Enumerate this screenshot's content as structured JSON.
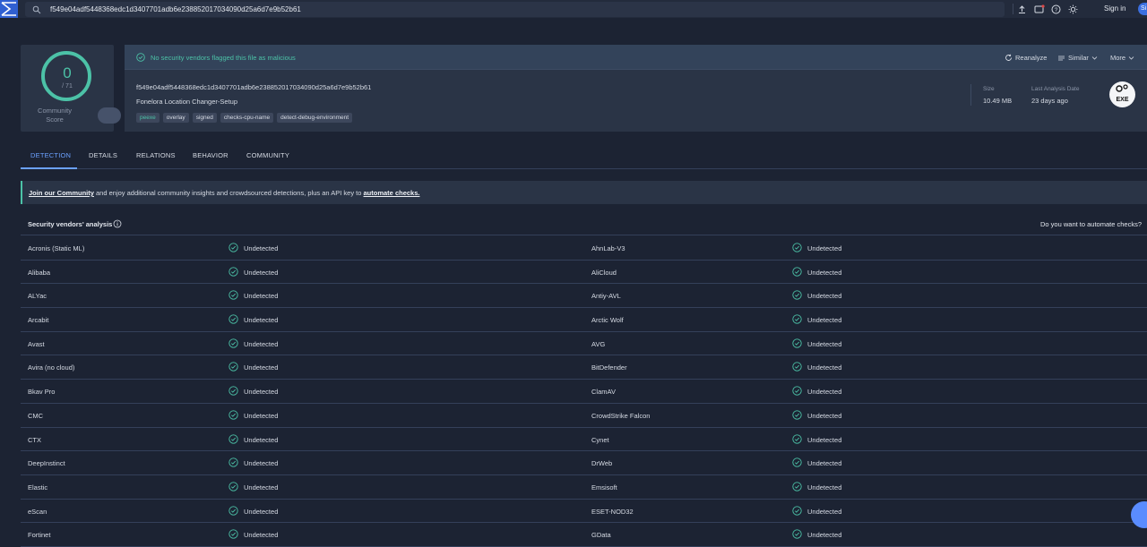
{
  "search": {
    "query": "f549e04adf5448368edc1d3407701adb6e238852017034090d25a6d7e9b52b61"
  },
  "topbar": {
    "sign_in": "Sign in",
    "sign_up": "Si"
  },
  "score": {
    "value": "0",
    "total": "/ 71",
    "community_label_line1": "Community",
    "community_label_line2": "Score"
  },
  "banner": {
    "message": "No security vendors flagged this file as malicious",
    "reanalyze": "Reanalyze",
    "similar": "Similar",
    "more": "More"
  },
  "file": {
    "hash": "f549e04adf5448368edc1d3407701adb6e238852017034090d25a6d7e9b52b61",
    "name": "Fonelora Location Changer-Setup",
    "tags": [
      "peexe",
      "overlay",
      "signed",
      "checks-cpu-name",
      "detect-debug-environment"
    ],
    "size_label": "Size",
    "size_value": "10.49 MB",
    "last_analysis_label": "Last Analysis Date",
    "last_analysis_value": "23 days ago",
    "type_badge": "EXE"
  },
  "tabs": [
    "DETECTION",
    "DETAILS",
    "RELATIONS",
    "BEHAVIOR",
    "COMMUNITY"
  ],
  "join": {
    "link1": "Join our Community",
    "mid": " and enjoy additional community insights and crowdsourced detections, plus an API key to ",
    "link2": "automate checks."
  },
  "vendors": {
    "title": "Security vendors' analysis",
    "automate": "Do you want to automate checks?",
    "rows": [
      {
        "left": "Acronis (Static ML)",
        "left_status": "Undetected",
        "right": "AhnLab-V3",
        "right_status": "Undetected"
      },
      {
        "left": "Alibaba",
        "left_status": "Undetected",
        "right": "AliCloud",
        "right_status": "Undetected"
      },
      {
        "left": "ALYac",
        "left_status": "Undetected",
        "right": "Antiy-AVL",
        "right_status": "Undetected"
      },
      {
        "left": "Arcabit",
        "left_status": "Undetected",
        "right": "Arctic Wolf",
        "right_status": "Undetected"
      },
      {
        "left": "Avast",
        "left_status": "Undetected",
        "right": "AVG",
        "right_status": "Undetected"
      },
      {
        "left": "Avira (no cloud)",
        "left_status": "Undetected",
        "right": "BitDefender",
        "right_status": "Undetected"
      },
      {
        "left": "Bkav Pro",
        "left_status": "Undetected",
        "right": "ClamAV",
        "right_status": "Undetected"
      },
      {
        "left": "CMC",
        "left_status": "Undetected",
        "right": "CrowdStrike Falcon",
        "right_status": "Undetected"
      },
      {
        "left": "CTX",
        "left_status": "Undetected",
        "right": "Cynet",
        "right_status": "Undetected"
      },
      {
        "left": "DeepInstinct",
        "left_status": "Undetected",
        "right": "DrWeb",
        "right_status": "Undetected"
      },
      {
        "left": "Elastic",
        "left_status": "Undetected",
        "right": "Emsisoft",
        "right_status": "Undetected"
      },
      {
        "left": "eScan",
        "left_status": "Undetected",
        "right": "ESET-NOD32",
        "right_status": "Undetected"
      },
      {
        "left": "Fortinet",
        "left_status": "Undetected",
        "right": "GData",
        "right_status": "Undetected"
      }
    ]
  },
  "colors": {
    "accent_green": "#4cc2a7",
    "accent_blue": "#6ba1ff",
    "bg": "#1c2333",
    "card": "#2a3446"
  }
}
